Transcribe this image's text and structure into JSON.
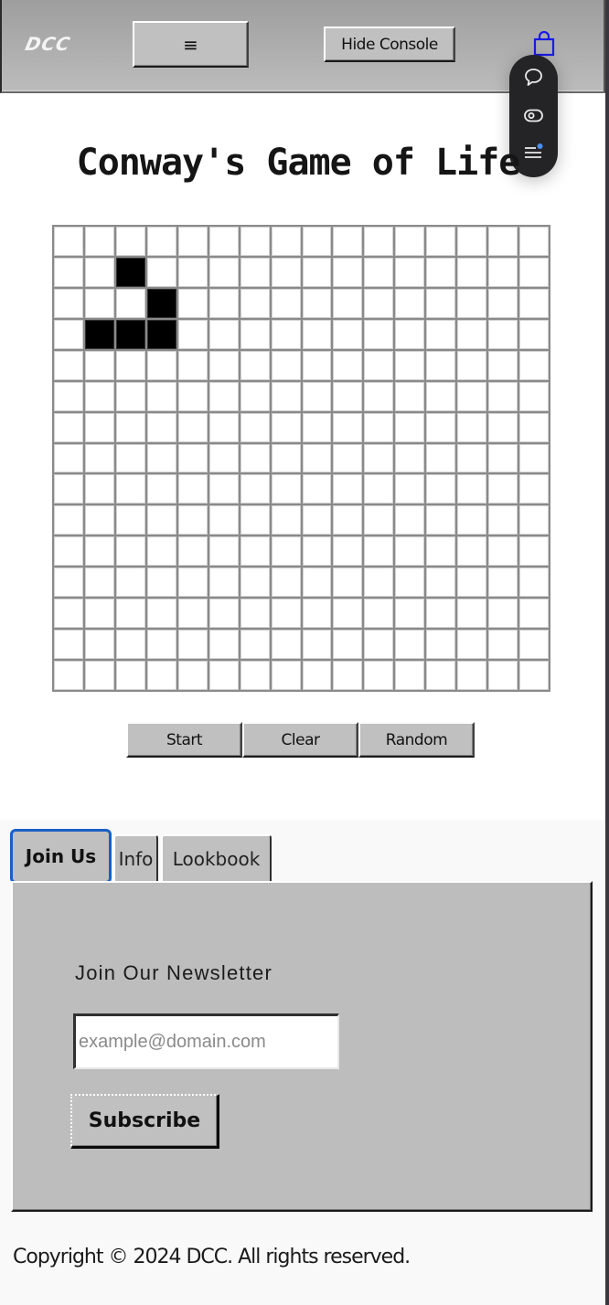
{
  "header": {
    "logo": "DCC",
    "menu_icon": "≡",
    "hide_console_label": "Hide Console",
    "cart_icon": "shopping-bag-icon",
    "cart_color": "#1a1ae6"
  },
  "floating_toolbar": {
    "items": [
      {
        "name": "chat-icon"
      },
      {
        "name": "eye-icon"
      },
      {
        "name": "list-notification-icon",
        "badge_color": "#4a8ff0"
      }
    ]
  },
  "game": {
    "title": "Conway's Game of Life",
    "rows": 15,
    "cols": 16,
    "alive_cells": [
      [
        1,
        2
      ],
      [
        2,
        3
      ],
      [
        3,
        1
      ],
      [
        3,
        2
      ],
      [
        3,
        3
      ]
    ],
    "buttons": {
      "start": "Start",
      "clear": "Clear",
      "random": "Random"
    }
  },
  "tabs": [
    {
      "label": "Join Us",
      "active": true
    },
    {
      "label": "Info",
      "active": false
    },
    {
      "label": "Lookbook",
      "active": false
    }
  ],
  "newsletter": {
    "heading": "Join Our Newsletter",
    "email_value": "",
    "email_placeholder": "example@domain.com",
    "subscribe_label": "Subscribe"
  },
  "footer": {
    "copyright": "Copyright © 2024 DCC. All rights reserved."
  },
  "colors": {
    "accent_focus": "#1a5fc4",
    "chrome_gray": "#c0c0c0",
    "panel_gray": "#bdbdbd"
  }
}
